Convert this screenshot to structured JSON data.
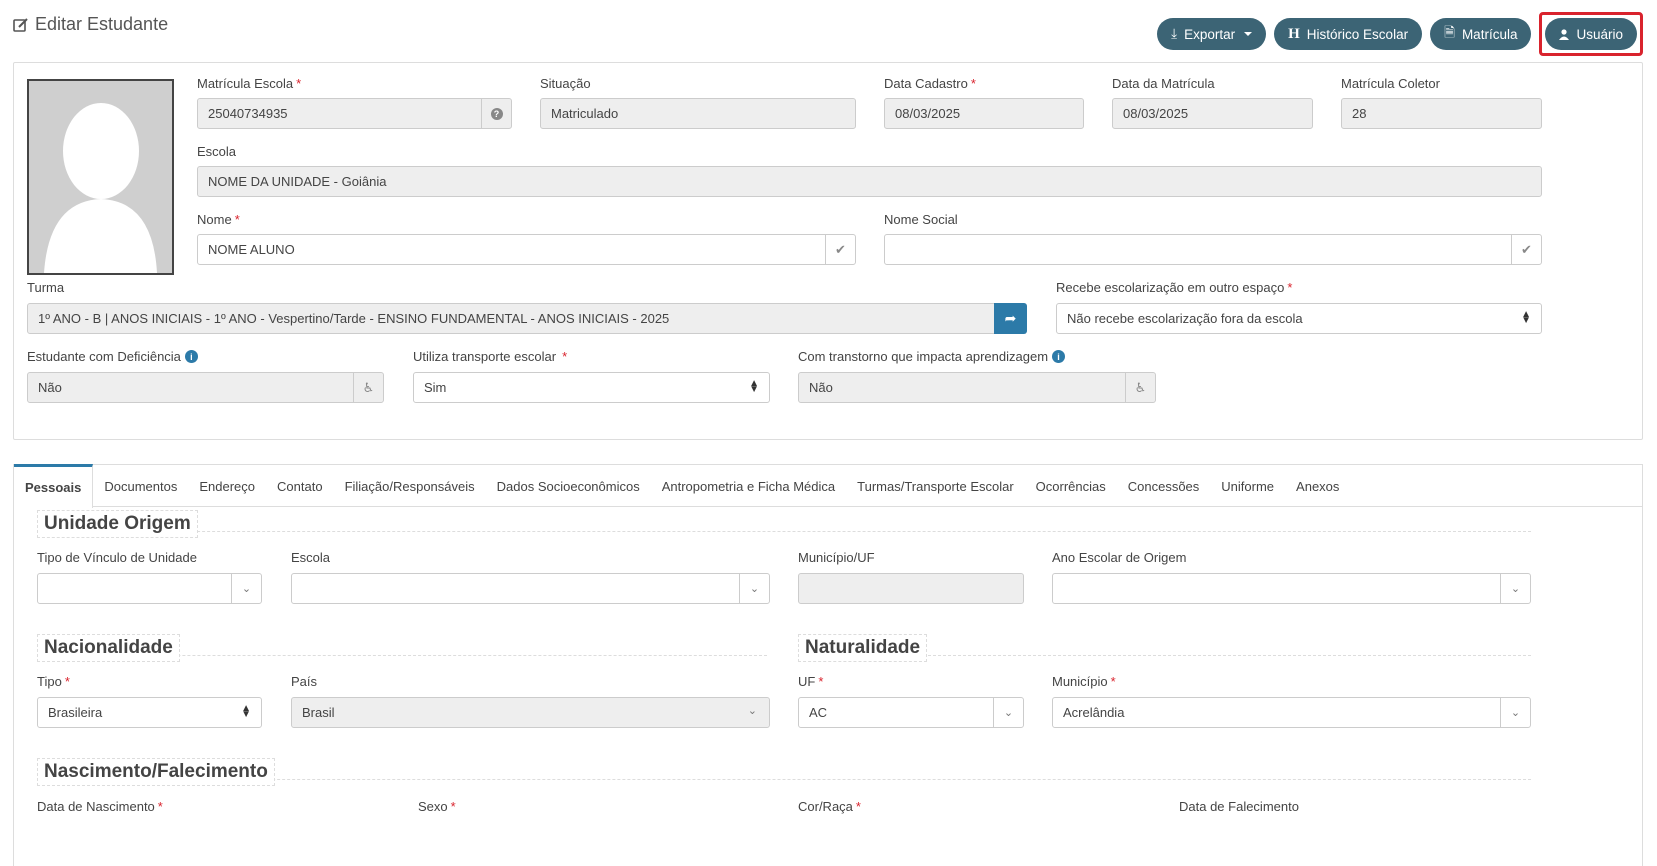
{
  "header": {
    "title": "Editar Estudante",
    "buttons": {
      "exportar": "Exportar",
      "historico": "Histórico Escolar",
      "matricula": "Matrícula",
      "usuario": "Usuário"
    }
  },
  "student": {
    "matricula_escola_label": "Matrícula Escola",
    "matricula_escola": "25040734935",
    "situacao_label": "Situação",
    "situacao": "Matriculado",
    "data_cadastro_label": "Data Cadastro",
    "data_cadastro": "08/03/2025",
    "data_matricula_label": "Data da Matrícula",
    "data_matricula": "08/03/2025",
    "matricula_coletor_label": "Matrícula Coletor",
    "matricula_coletor": "28",
    "escola_label": "Escola",
    "escola": "NOME DA UNIDADE - Goiânia",
    "nome_label": "Nome",
    "nome": "NOME ALUNO",
    "nome_social_label": "Nome Social",
    "nome_social": "",
    "turma_label": "Turma",
    "turma": "1º ANO - B | ANOS INICIAIS - 1º ANO - Vespertino/Tarde - ENSINO FUNDAMENTAL - ANOS INICIAIS - 2025",
    "recebe_label": "Recebe escolarização em outro espaço",
    "recebe": "Não recebe escolarização fora da escola",
    "deficiencia_label": "Estudante com Deficiência",
    "deficiencia": "Não",
    "transporte_label": "Utiliza transporte escolar",
    "transporte": "Sim",
    "transtorno_label": "Com transtorno que impacta aprendizagem",
    "transtorno": "Não"
  },
  "tabs": [
    "Pessoais",
    "Documentos",
    "Endereço",
    "Contato",
    "Filiação/Responsáveis",
    "Dados Socioeconômicos",
    "Antropometria e Ficha Médica",
    "Turmas/Transporte Escolar",
    "Ocorrências",
    "Concessões",
    "Uniforme",
    "Anexos"
  ],
  "pessoais": {
    "unidade_origem": "Unidade Origem",
    "tipo_vinculo_label": "Tipo de Vínculo de Unidade",
    "escola_label": "Escola",
    "municipio_uf_label": "Município/UF",
    "ano_escolar_label": "Ano Escolar de Origem",
    "nacionalidade": "Nacionalidade",
    "tipo_label": "Tipo",
    "tipo": "Brasileira",
    "pais_label": "País",
    "pais": "Brasil",
    "naturalidade": "Naturalidade",
    "uf_label": "UF",
    "uf": "AC",
    "municipio_label": "Município",
    "municipio": "Acrelândia",
    "nascimento": "Nascimento/Falecimento",
    "data_nascimento_label": "Data de Nascimento",
    "sexo_label": "Sexo",
    "cor_raca_label": "Cor/Raça",
    "data_falecimento_label": "Data de Falecimento"
  },
  "colors": {
    "button": "#3c6475",
    "required": "#d9232d",
    "highlight": "#d9232d",
    "accent": "#2c7aa8"
  },
  "req_mark": "*"
}
